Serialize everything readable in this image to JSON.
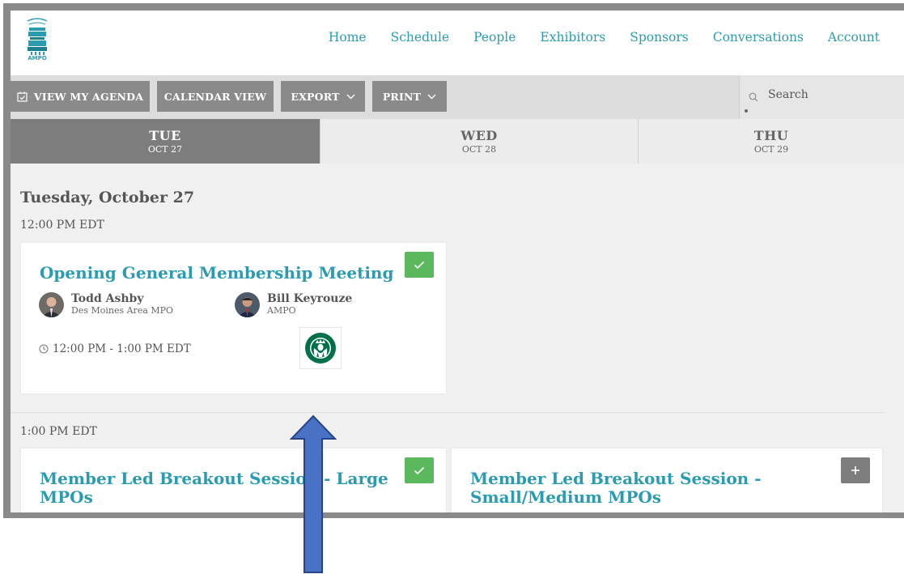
{
  "nav": {
    "logo_text": "AMPO",
    "links": [
      "Home",
      "Schedule",
      "People",
      "Exhibitors",
      "Sponsors",
      "Conversations",
      "Account"
    ]
  },
  "toolbar": {
    "view_agenda": "VIEW MY AGENDA",
    "calendar_view": "CALENDAR VIEW",
    "export": "EXPORT",
    "print": "PRINT",
    "search_placeholder": "Search"
  },
  "day_tabs": [
    {
      "day": "TUE",
      "date": "OCT 27",
      "active": true
    },
    {
      "day": "WED",
      "date": "OCT 28",
      "active": false
    },
    {
      "day": "THU",
      "date": "OCT 29",
      "active": false
    }
  ],
  "schedule": {
    "day_heading": "Tuesday, October 27",
    "slots": [
      {
        "time": "12:00 PM EDT",
        "sessions": [
          {
            "title": "Opening General Membership Meeting",
            "in_agenda": true,
            "speakers": [
              {
                "name": "Todd Ashby",
                "org": "Des Moines Area MPO"
              },
              {
                "name": "Bill Keyrouze",
                "org": "AMPO"
              }
            ],
            "time_range": "12:00 PM - 1:00 PM EDT",
            "sponsor_icon": "starbucks-logo"
          }
        ]
      },
      {
        "time": "1:00 PM EDT",
        "sessions": [
          {
            "title_line1": "Member Led Breakout Session - Large",
            "title_line2": "MPOs",
            "in_agenda": true
          },
          {
            "title_line1": "Member Led Breakout Session -",
            "title_line2": "Small/Medium MPOs",
            "in_agenda": false
          }
        ]
      }
    ]
  },
  "colors": {
    "accent": "#2a9bb0",
    "check_green": "#5cb85c",
    "button_gray": "#8a8a8a",
    "arrow_blue": "#4a72c4"
  }
}
